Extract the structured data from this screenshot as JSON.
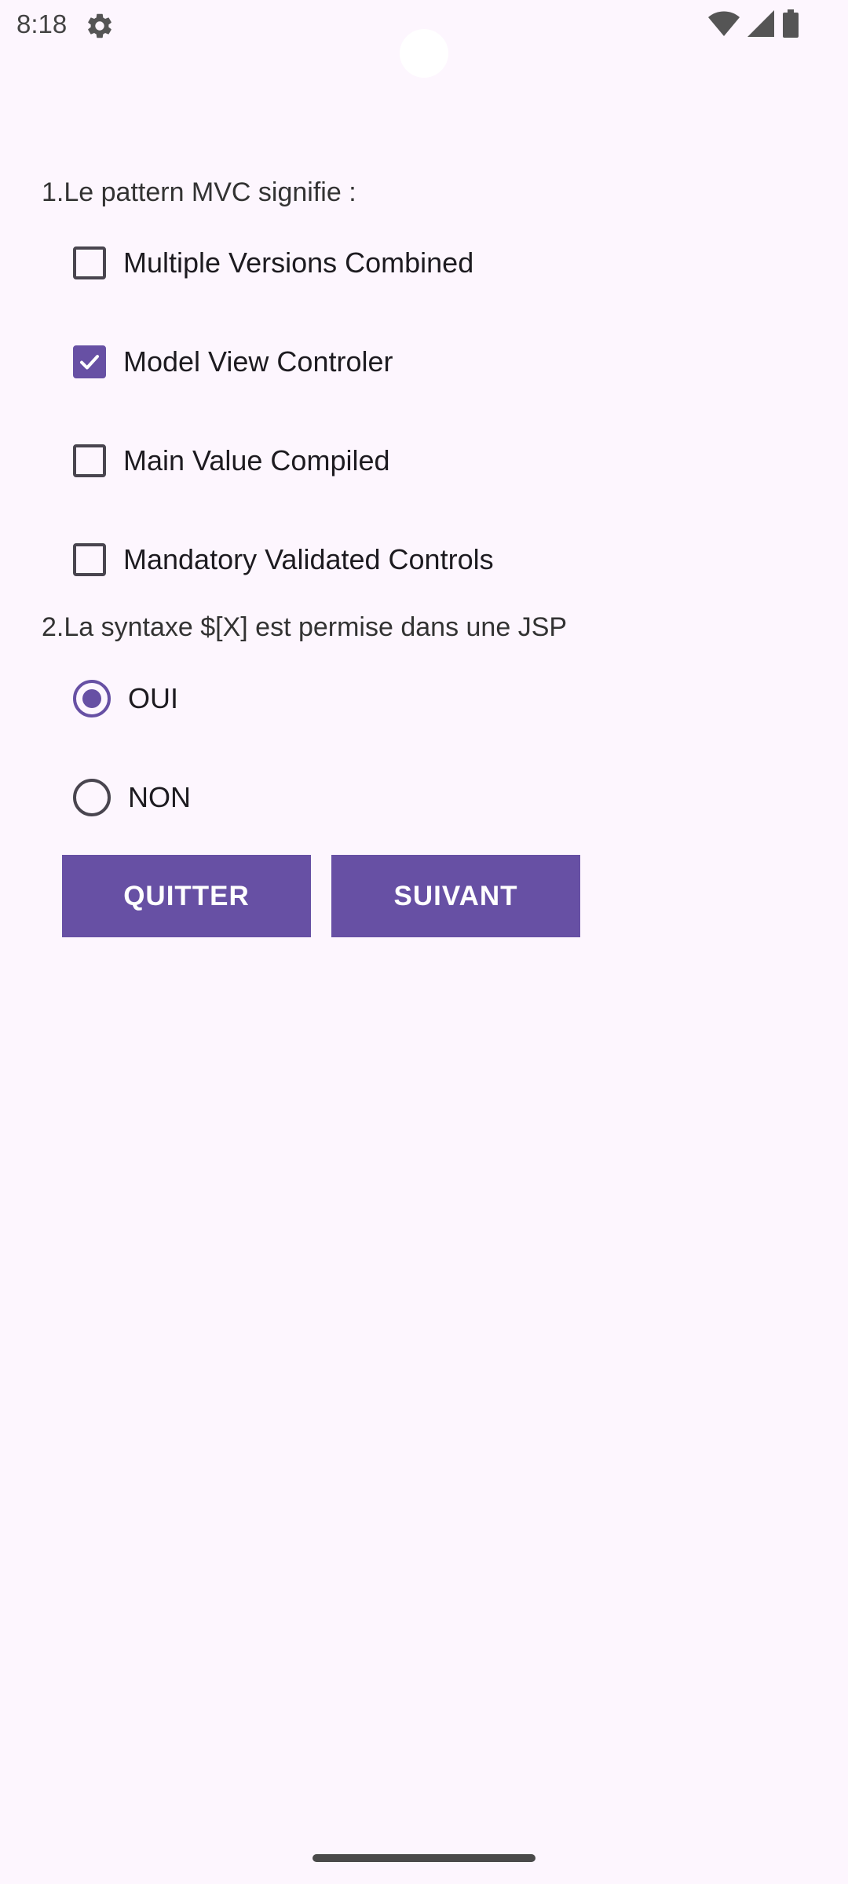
{
  "status_bar": {
    "time": "8:18",
    "icons": [
      "gear-icon",
      "wifi-icon",
      "signal-icon",
      "battery-icon"
    ]
  },
  "quiz": {
    "q1": {
      "text": "1.Le pattern MVC signifie :",
      "options": [
        {
          "label": "Multiple Versions Combined",
          "checked": false
        },
        {
          "label": "Model View Controler",
          "checked": true
        },
        {
          "label": "Main Value Compiled",
          "checked": false
        },
        {
          "label": "Mandatory Validated Controls",
          "checked": false
        }
      ]
    },
    "q2": {
      "text": "2.La syntaxe $[X] est permise dans une JSP",
      "options": [
        {
          "label": "OUI",
          "selected": true
        },
        {
          "label": "NON",
          "selected": false
        }
      ]
    }
  },
  "buttons": {
    "quit": "QUITTER",
    "next": "SUIVANT"
  },
  "colors": {
    "accent": "#6750A4",
    "background": "#FDF6FE"
  }
}
